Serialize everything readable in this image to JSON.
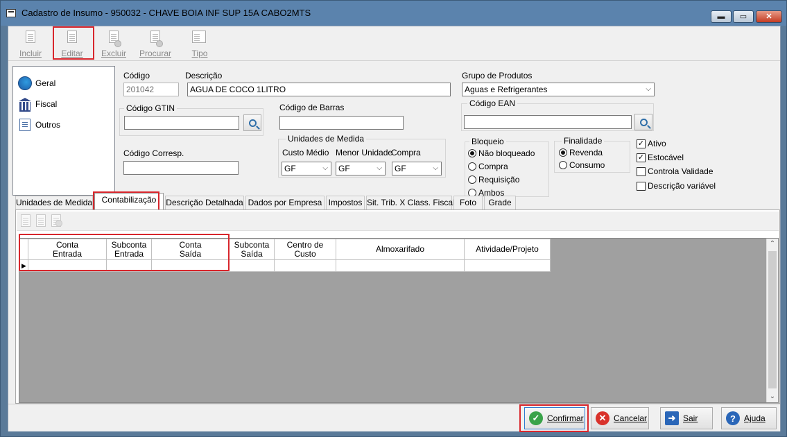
{
  "window": {
    "title": "Cadastro de Insumo - 950032 - CHAVE BOIA INF SUP 15A  CABO2MTS",
    "min_label": "▬",
    "max_label": "▭",
    "close_label": "✕"
  },
  "toolbar": {
    "incluir": "Incluir",
    "editar": "Editar",
    "excluir": "Excluir",
    "procurar": "Procurar",
    "tipo": "Tipo"
  },
  "nav": {
    "items": [
      {
        "label": "Geral",
        "icon": "globe-icon"
      },
      {
        "label": "Fiscal",
        "icon": "bank-icon"
      },
      {
        "label": "Outros",
        "icon": "documents-icon"
      }
    ]
  },
  "form": {
    "codigo_label": "Código",
    "codigo_value": "201042",
    "descricao_label": "Descrição",
    "descricao_value": "AGUA DE COCO 1LITRO",
    "grupo_label": "Grupo de Produtos",
    "grupo_value": "Aguas e Refrigerantes",
    "gtin_label": "Código GTIN",
    "gtin_value": "",
    "barras_label": "Código de Barras",
    "barras_value": "",
    "ean_label": "Código EAN",
    "ean_value": "",
    "corresp_label": "Código Corresp.",
    "corresp_value": "",
    "unidades_label": "Unidades de Medida",
    "custo_medio_label": "Custo Médio",
    "custo_medio_value": "GF",
    "menor_unidade_label": "Menor Unidade",
    "menor_unidade_value": "GF",
    "compra_label": "Compra",
    "compra_value": "GF",
    "bloqueio_label": "Bloqueio",
    "bloqueio_options": [
      "Não bloqueado",
      "Compra",
      "Requisição",
      "Ambos"
    ],
    "bloqueio_selected": "Não bloqueado",
    "finalidade_label": "Finalidade",
    "finalidade_options": [
      "Revenda",
      "Consumo"
    ],
    "finalidade_selected": "Revenda",
    "checks": [
      {
        "label": "Ativo",
        "checked": true
      },
      {
        "label": "Estocável",
        "checked": true
      },
      {
        "label": "Controla Validade",
        "checked": false
      },
      {
        "label": "Descrição variável",
        "checked": false
      }
    ]
  },
  "tabs": [
    "Unidades de Medida",
    "Contabilização",
    "Descrição Detalhada",
    "Dados por Empresa",
    "Impostos",
    "Sit. Trib. X Class. Fiscal",
    "Foto",
    "Grade"
  ],
  "active_tab": "Contabilização",
  "grid": {
    "columns": [
      {
        "line1": "Conta",
        "line2": "Entrada"
      },
      {
        "line1": "Subconta",
        "line2": "Entrada"
      },
      {
        "line1": "Conta",
        "line2": "Saída"
      },
      {
        "line1": "Subconta",
        "line2": "Saída"
      },
      {
        "line1": "Centro de Custo",
        "line2": ""
      },
      {
        "line1": "Almoxarifado",
        "line2": ""
      },
      {
        "line1": "Atividade/Projeto",
        "line2": ""
      }
    ],
    "row_indicator": "▶"
  },
  "buttons": {
    "confirmar": "Confirmar",
    "cancelar": "Cancelar",
    "sair": "Sair",
    "ajuda": "Ajuda"
  },
  "colors": {
    "highlight": "#d8262c",
    "confirm": "#3aa34a",
    "cancel": "#d9322b",
    "help": "#2a66b8"
  }
}
